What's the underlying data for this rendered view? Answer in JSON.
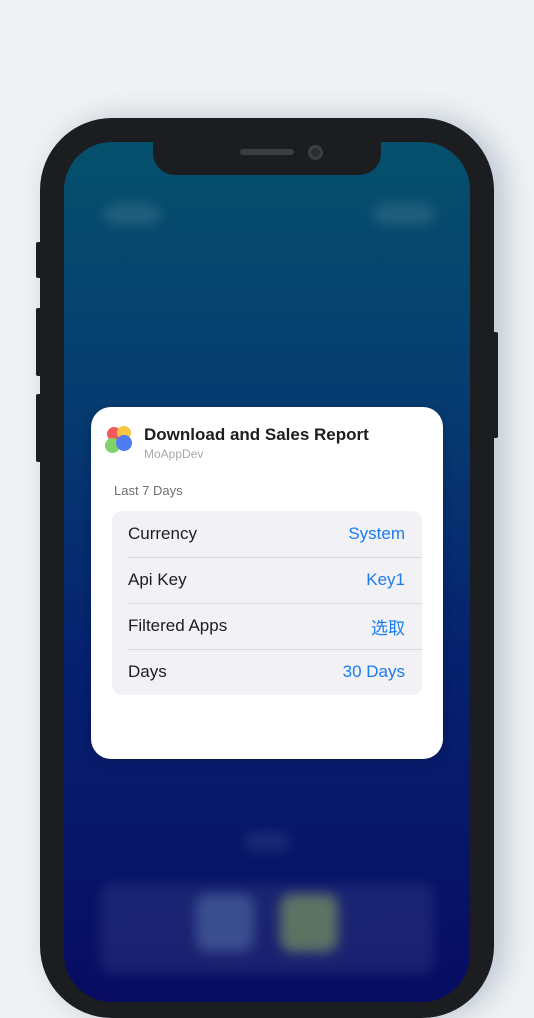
{
  "widget": {
    "title": "Download and Sales Report",
    "developer": "MoAppDev",
    "period_label": "Last 7 Days",
    "settings": [
      {
        "label": "Currency",
        "value": "System"
      },
      {
        "label": "Api Key",
        "value": "Key1"
      },
      {
        "label": "Filtered Apps",
        "value": "选取"
      },
      {
        "label": "Days",
        "value": "30 Days"
      }
    ]
  },
  "colors": {
    "accent": "#1a7cf0",
    "page_background": "#eef2f2",
    "phone_frame": "#1b1d20",
    "wallpaper_top": "#05506c",
    "wallpaper_bottom": "#080c63"
  }
}
